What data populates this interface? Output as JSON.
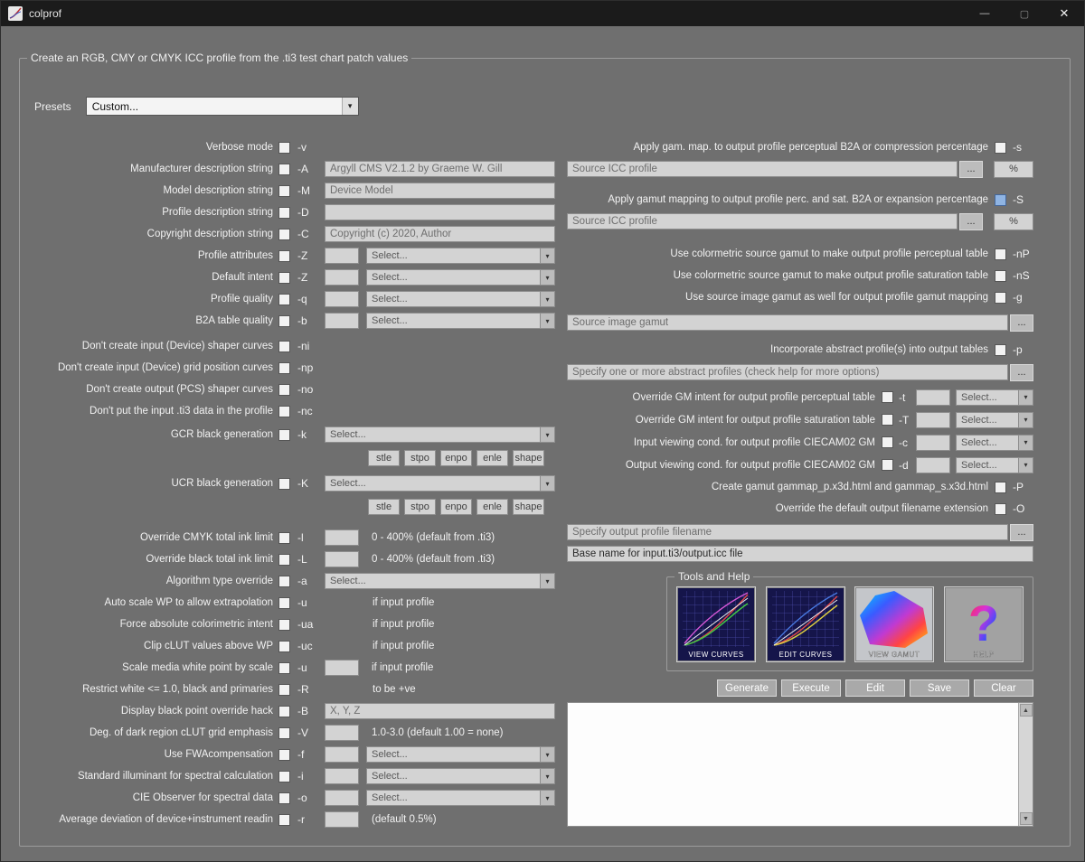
{
  "window": {
    "title": "colprof",
    "minimize_icon": "—",
    "maximize_icon": "▢",
    "close_icon": "✕"
  },
  "c": {
    "select": "Select...",
    "browse": "...",
    "percent": "%",
    "chevron": "▾",
    "scroll_up": "▲",
    "scroll_down": "▼"
  },
  "groupbox_title": "Create an RGB, CMY or CMYK ICC profile from the .ti3 test chart patch values",
  "presets": {
    "label": "Presets",
    "value": "Custom..."
  },
  "left": {
    "verbose": {
      "label": "Verbose mode",
      "flag": "-v"
    },
    "manufacturer": {
      "label": "Manufacturer description string",
      "flag": "-A",
      "value": "Argyll CMS V2.1.2 by Graeme W. Gill"
    },
    "model": {
      "label": "Model description string",
      "flag": "-M",
      "value": "Device Model"
    },
    "profile_desc": {
      "label": "Profile description string",
      "flag": "-D",
      "value": ""
    },
    "copyright": {
      "label": "Copyright description string",
      "flag": "-C",
      "value": "Copyright (c) 2020, Author"
    },
    "attributes": {
      "label": "Profile attributes",
      "flag": "-Z"
    },
    "default_intent": {
      "label": "Default intent",
      "flag": "-Z"
    },
    "quality": {
      "label": "Profile quality",
      "flag": "-q"
    },
    "b2a_quality": {
      "label": "B2A table quality",
      "flag": "-b"
    },
    "no_in_shaper": {
      "label": "Don't create input (Device) shaper curves",
      "flag": "-ni"
    },
    "no_in_grid": {
      "label": "Don't create input (Device) grid position curves",
      "flag": "-np"
    },
    "no_out_shaper": {
      "label": "Don't create output (PCS) shaper curves",
      "flag": "-no"
    },
    "no_ti3": {
      "label": "Don't put the input .ti3 data in the profile",
      "flag": "-nc"
    },
    "gcr": {
      "label": "GCR black generation",
      "flag": "-k"
    },
    "ucr": {
      "label": "UCR black generation",
      "flag": "-K"
    },
    "kparams": [
      "stle",
      "stpo",
      "enpo",
      "enle",
      "shape"
    ],
    "ink_limit": {
      "label": "Override CMYK total ink limit",
      "flag": "-l",
      "hint": "0 - 400% (default from .ti3)"
    },
    "black_limit": {
      "label": "Override black total ink limit",
      "flag": "-L",
      "hint": "0 - 400% (default from .ti3)"
    },
    "algorithm": {
      "label": "Algorithm type override",
      "flag": "-a"
    },
    "auto_wp": {
      "label": "Auto scale WP to allow extrapolation",
      "flag": "-u",
      "hint": "if input profile"
    },
    "force_abs": {
      "label": "Force absolute colorimetric intent",
      "flag": "-ua",
      "hint": "if input profile"
    },
    "clip_clut": {
      "label": "Clip cLUT values above WP",
      "flag": "-uc",
      "hint": "if input profile"
    },
    "scale_wp": {
      "label": "Scale media white point by scale",
      "flag": "-u",
      "hint": "if input profile"
    },
    "restrict": {
      "label": "Restrict white <= 1.0, black and primaries",
      "flag": "-R",
      "hint": "to be +ve"
    },
    "black_hack": {
      "label": "Display black point override hack",
      "flag": "-B",
      "value": "X, Y, Z"
    },
    "dark_emph": {
      "label": "Deg. of dark region cLUT grid emphasis",
      "flag": "-V",
      "hint": "1.0-3.0 (default 1.00 = none)"
    },
    "fwa": {
      "label": "Use FWAcompensation",
      "flag": "-f"
    },
    "illuminant": {
      "label": "Standard illuminant for spectral calculation",
      "flag": "-i"
    },
    "observer": {
      "label": "CIE Observer for spectral data",
      "flag": "-o"
    },
    "avg_dev": {
      "label": "Average deviation of device+instrument readin",
      "flag": "-r",
      "hint": "(default 0.5%)"
    }
  },
  "right": {
    "gam_percep": {
      "label": "Apply gam. map. to output profile perceptual B2A or compression percentage",
      "flag": "-s"
    },
    "src_icc1": {
      "placeholder": "Source ICC profile"
    },
    "gam_sat": {
      "label": "Apply gamut mapping to output profile perc. and sat. B2A or expansion percentage",
      "flag": "-S",
      "checked": true
    },
    "src_icc2": {
      "placeholder": "Source ICC profile"
    },
    "col_percep": {
      "label": "Use colormetric source gamut to make output profile perceptual table",
      "flag": "-nP"
    },
    "col_sat": {
      "label": "Use colormetric source gamut to make output profile saturation table",
      "flag": "-nS"
    },
    "img_gamut": {
      "label": "Use source image gamut as well for output profile gamut mapping",
      "flag": "-g"
    },
    "src_gamut": {
      "placeholder": "Source image gamut"
    },
    "abstract": {
      "label": "Incorporate abstract profile(s) into output tables",
      "flag": "-p"
    },
    "abstract_field": {
      "placeholder": "Specify one or more abstract profiles (check help for more options)"
    },
    "gm_percep": {
      "label": "Override GM intent for output profile perceptual table",
      "flag": "-t"
    },
    "gm_sat": {
      "label": "Override GM intent for output profile saturation table",
      "flag": "-T"
    },
    "in_view": {
      "label": "Input viewing cond. for output profile CIECAM02 GM",
      "flag": "-c"
    },
    "out_view": {
      "label": "Output viewing cond. for output profile CIECAM02 GM",
      "flag": "-d"
    },
    "create_gamut": {
      "label": "Create gamut gammap_p.x3d.html and gammap_s.x3d.html",
      "flag": "-P"
    },
    "override_ext": {
      "label": "Override the default output filename extension",
      "flag": "-O"
    },
    "out_file": {
      "placeholder": "Specify output profile filename"
    },
    "base_name": {
      "value": "Base name for input.ti3/output.icc file"
    },
    "tools": {
      "title": "Tools and Help",
      "buttons": [
        "VIEW CURVES",
        "EDIT CURVES",
        "VIEW GAMUT",
        "HELP"
      ]
    },
    "actions": [
      "Generate",
      "Execute",
      "Edit",
      "Save",
      "Clear"
    ]
  }
}
